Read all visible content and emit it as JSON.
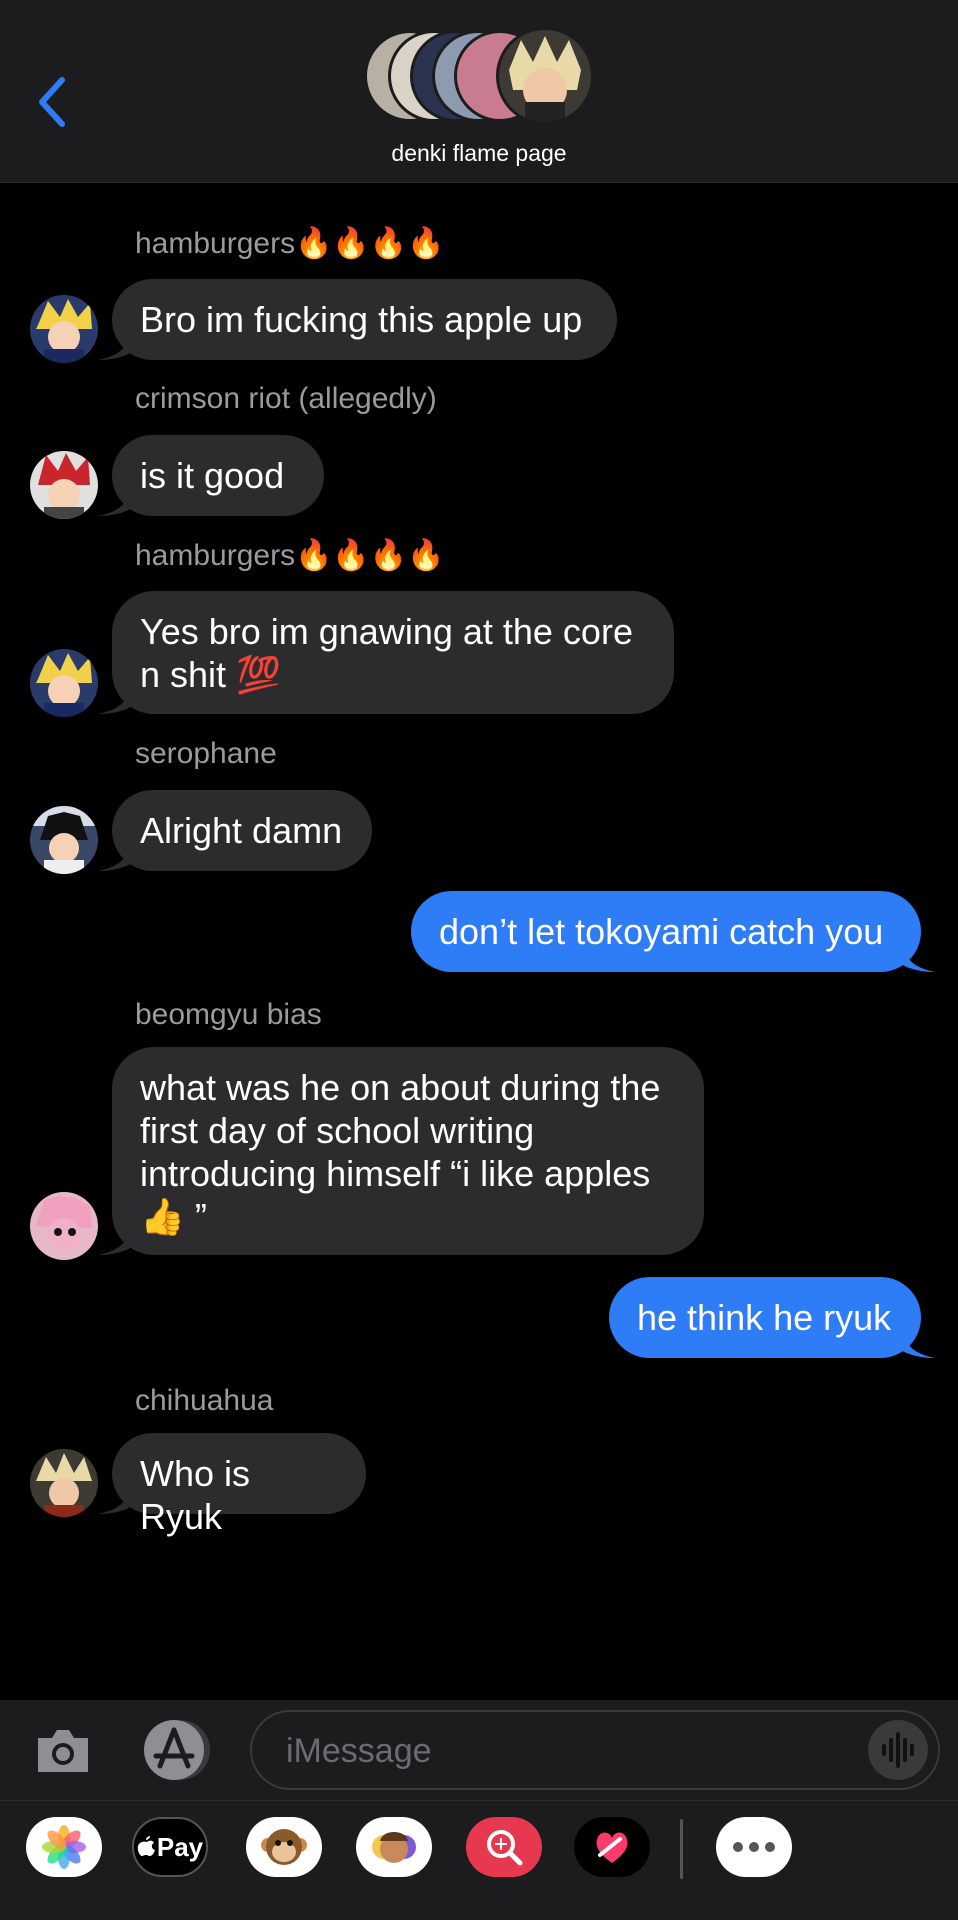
{
  "header": {
    "group_name": "denki flame page"
  },
  "messages": [
    {
      "sender": "hamburgers🔥🔥🔥🔥",
      "text": "Bro im fucking this apple up",
      "direction": "incoming"
    },
    {
      "sender": "crimson riot (allegedly)",
      "text": "is it good",
      "direction": "incoming"
    },
    {
      "sender": "hamburgers🔥🔥🔥🔥",
      "text": "Yes bro im gnawing at the core\nn shit 💯",
      "direction": "incoming"
    },
    {
      "sender": "serophane",
      "text": "Alright damn",
      "direction": "incoming"
    },
    {
      "text": "don’t let tokoyami catch you",
      "direction": "outgoing"
    },
    {
      "sender": "beomgyu bias",
      "text": "what was he on about during the\nfirst day of school writing\nintroducing himself “i like apples\n👍 ”",
      "direction": "incoming"
    },
    {
      "text": "he think he ryuk",
      "direction": "outgoing"
    },
    {
      "sender": "chihuahua",
      "text": "Who is Ryuk",
      "direction": "incoming"
    }
  ],
  "composer": {
    "placeholder": "iMessage"
  },
  "app_drawer": {
    "apple_pay_label": " Pay",
    "icons": [
      "photos-icon",
      "apple-pay-icon",
      "animoji-icon",
      "memoji-icon",
      "image-search-icon",
      "digital-touch-icon",
      "more-icon"
    ]
  },
  "colors": {
    "outgoing_bubble": "#2e7cf6",
    "incoming_bubble": "#2c2c2e",
    "background": "#000000",
    "accent": "#2e7cf6"
  }
}
